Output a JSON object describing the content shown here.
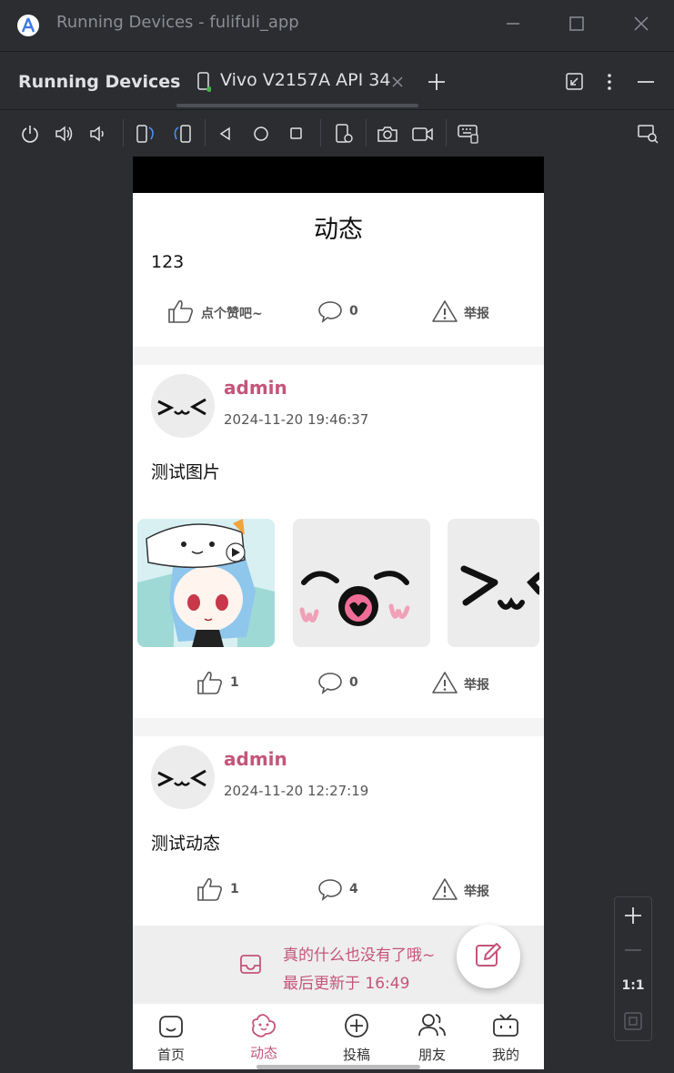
{
  "window": {
    "title": "Running Devices - fulifuli_app"
  },
  "tool_window": {
    "header": "Running Devices",
    "device_tab": "Vivo V2157A API 34"
  },
  "toolbar": {
    "icons": [
      "power-icon",
      "volume-up-icon",
      "volume-down-icon",
      "rotate-left-icon",
      "rotate-right-icon",
      "back-icon",
      "home-icon",
      "overview-icon",
      "device-settings-icon",
      "screenshot-icon",
      "screen-record-icon",
      "keyboard-icon",
      "device-explorer-icon"
    ]
  },
  "zoom": {
    "ratio": "1:1"
  },
  "app": {
    "page_title": "动态",
    "posts": [
      {
        "text": "123",
        "actions": {
          "like": "点个赞吧~",
          "comment": "0",
          "report": "举报"
        }
      },
      {
        "username": "admin",
        "time": "2024-11-20 19:46:37",
        "text": "测试图片",
        "actions": {
          "like": "1",
          "comment": "0",
          "report": "举报"
        }
      },
      {
        "username": "admin",
        "time": "2024-11-20 12:27:19",
        "text": "测试动态",
        "actions": {
          "like": "1",
          "comment": "4",
          "report": "举报"
        }
      }
    ],
    "footer": {
      "line1": "真的什么也没有了哦~",
      "line2": "最后更新于 16:49"
    },
    "nav": [
      {
        "label": "首页",
        "icon": "home-face-icon"
      },
      {
        "label": "动态",
        "icon": "dynamic-icon",
        "active": true
      },
      {
        "label": "投稿",
        "icon": "add-circle-icon"
      },
      {
        "label": "朋友",
        "icon": "friends-icon"
      },
      {
        "label": "我的",
        "icon": "tv-icon"
      }
    ],
    "colors": {
      "accent": "#c4557a"
    }
  }
}
